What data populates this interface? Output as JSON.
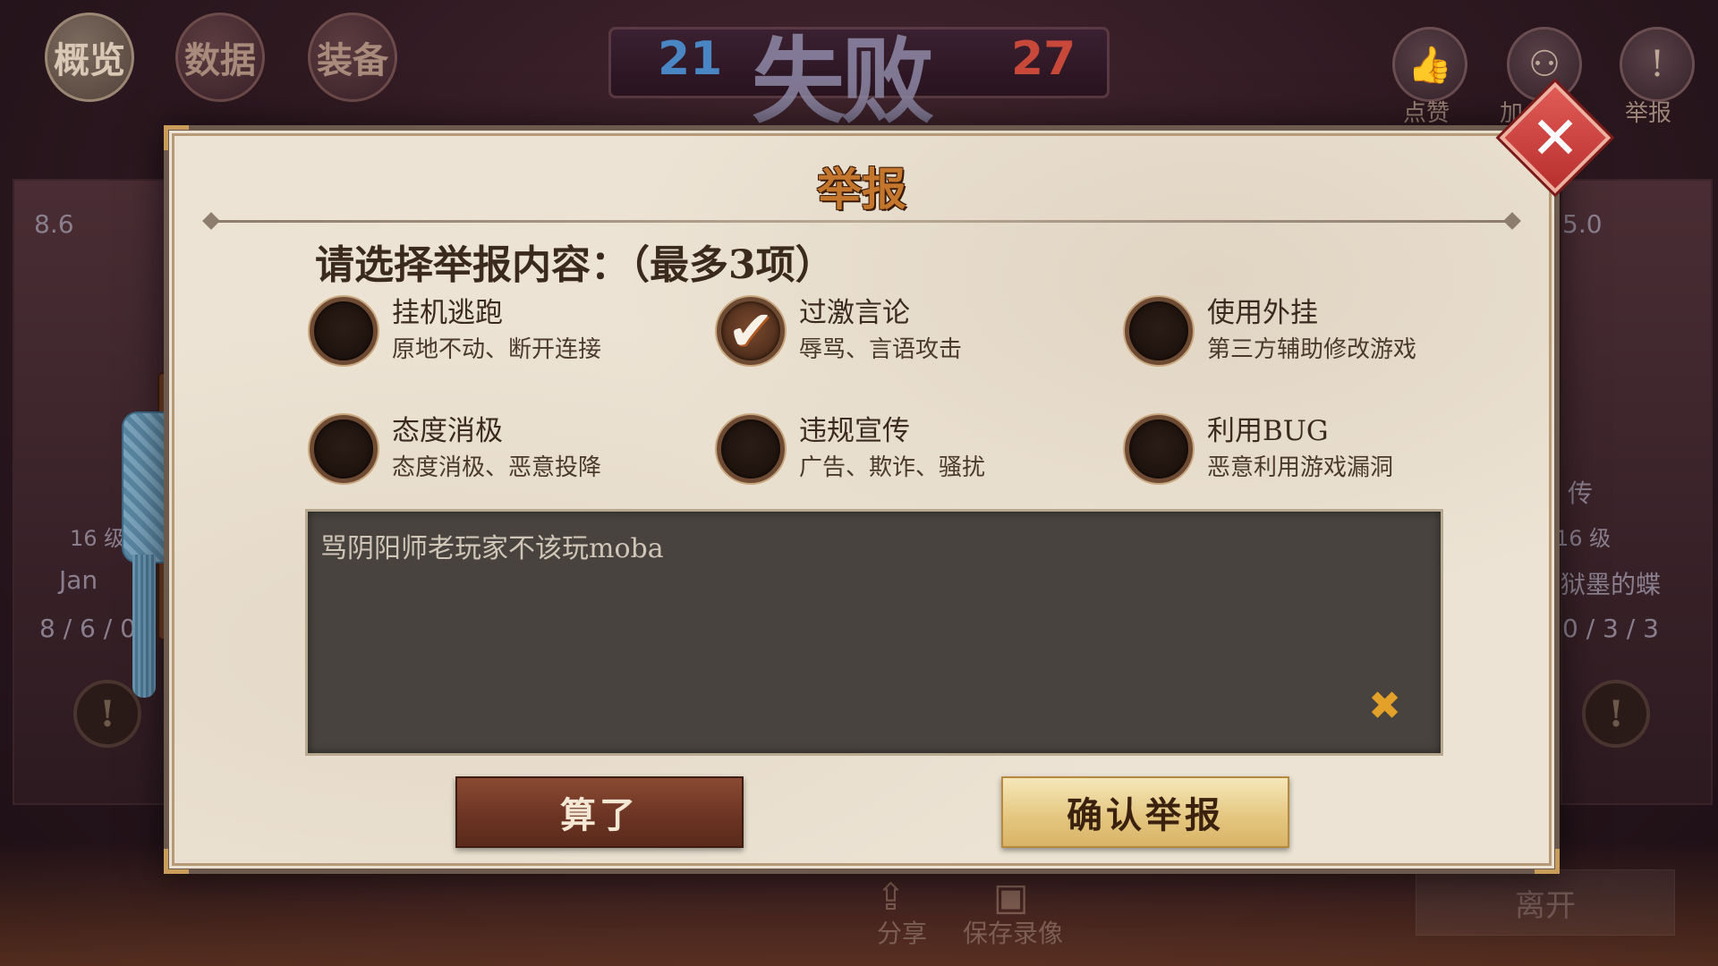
{
  "background": {
    "tabs": [
      "概览",
      "数据",
      "装备"
    ],
    "score_blue": "21",
    "score_red": "27",
    "result_text": "失败",
    "top_icons": [
      {
        "icon": "thumbs-up-icon",
        "glyph": "👍",
        "label": "点赞"
      },
      {
        "icon": "add-friend-icon",
        "glyph": "⚇",
        "label": "加"
      },
      {
        "icon": "report-icon",
        "glyph": "!",
        "label": "举报"
      }
    ],
    "left_panel": {
      "score": "8.6",
      "level": "16 级",
      "name": "Jan",
      "kda": "8 / 6 / 0"
    },
    "right_panel": {
      "score": "5.0",
      "title_tail": "传",
      "level": "16 级",
      "name": "狱墨的蝶",
      "kda": "0 / 3 / 3"
    },
    "bottom_actions": [
      {
        "icon": "share-icon",
        "glyph": "⇪",
        "label": "分享"
      },
      {
        "icon": "video-camera-icon",
        "glyph": "▣",
        "label": "保存录像"
      }
    ],
    "leave_label": "离开"
  },
  "modal": {
    "title": "举报",
    "instruction": "请选择举报内容：（最多3项）",
    "options": [
      {
        "label": "挂机逃跑",
        "desc": "原地不动、断开连接",
        "checked": false
      },
      {
        "label": "过激言论",
        "desc": "辱骂、言语攻击",
        "checked": true
      },
      {
        "label": "使用外挂",
        "desc": "第三方辅助修改游戏",
        "checked": false
      },
      {
        "label": "态度消极",
        "desc": "态度消极、恶意投降",
        "checked": false
      },
      {
        "label": "违规宣传",
        "desc": "广告、欺诈、骚扰",
        "checked": false
      },
      {
        "label": "利用BUG",
        "desc": "恶意利用游戏漏洞",
        "checked": false
      }
    ],
    "textarea_value": "骂阴阳师老玩家不该玩moba",
    "clear_glyph": "✖",
    "cancel_label": "算了",
    "confirm_label": "确认举报",
    "close_glyph": "✕",
    "check_glyph": "✔"
  },
  "colors": {
    "accent_gold": "#e3a12a",
    "title_orange": "#c4762c",
    "cancel_brown": "#6a3322",
    "confirm_gold": "#e4c57e",
    "close_red": "#c8403c"
  }
}
